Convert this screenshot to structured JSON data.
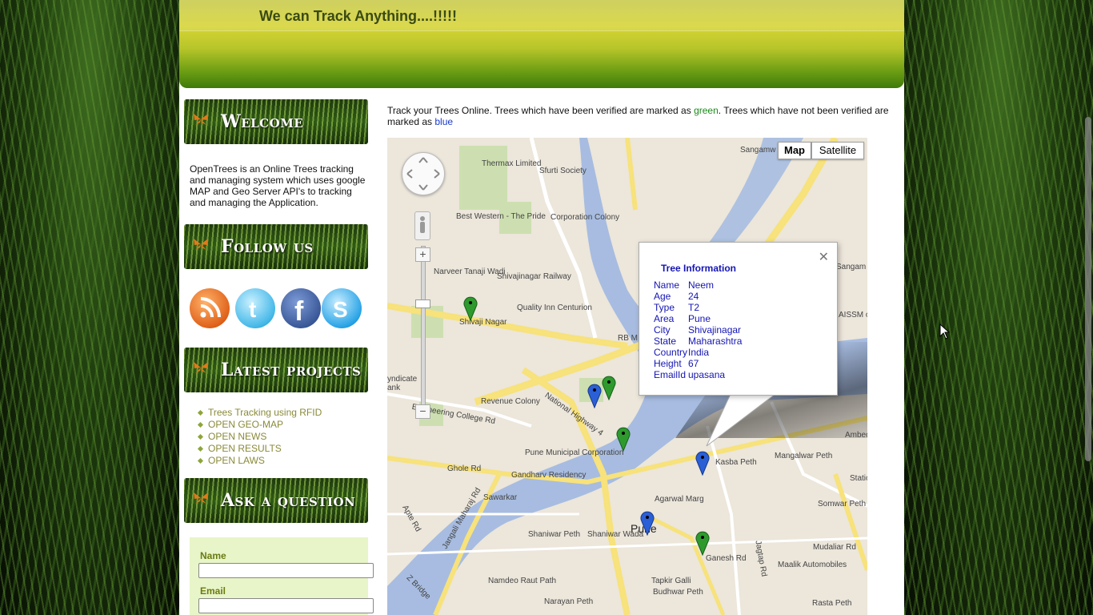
{
  "header": {
    "tagline": "We can Track Anything....!!!!!"
  },
  "sidebar": {
    "welcome_title": "Welcome",
    "intro": "OpenTrees is an Online Trees tracking and managing system which uses google MAP and Geo Server API's to tracking and managing the Application.",
    "follow_title": "Follow us",
    "social": [
      "rss-icon",
      "twitter-icon",
      "facebook-icon",
      "skype-icon"
    ],
    "projects_title": "Latest projects",
    "projects": [
      "Trees Tracking using RFID",
      "OPEN GEO-MAP",
      "OPEN NEWS",
      "OPEN RESULTS",
      "OPEN LAWS"
    ],
    "ask_title": "Ask a question",
    "form": {
      "name_label": "Name",
      "email_label": "Email",
      "name_value": "",
      "email_value": ""
    }
  },
  "content": {
    "desc_prefix": "Track your Trees Online. Trees which have been verified are marked as ",
    "desc_green": "green",
    "desc_mid": ". Trees which have not been verified are marked as ",
    "desc_blue": "blue",
    "colors": {
      "verified": "#2e9a2e",
      "unverified": "#2b5fd6"
    }
  },
  "map": {
    "type_map": "Map",
    "type_satellite": "Satellite",
    "selected_type": "Map",
    "labels": {
      "thermax": "Thermax Limited",
      "sfurti": "Sfurti Society",
      "bestwestern": "Best Western - The Pride",
      "corporation": "Corporation Colony",
      "narveer": "Narveer Tanaji Wadi",
      "shivajinagar_rly": "Shivajinagar Railway",
      "quality": "Quality Inn Centurion",
      "shivaji": "Shivaji Nagar",
      "revenue": "Revenue Colony",
      "engg": "Engineering College Rd",
      "nh4": "National Highway 4",
      "pmc": "Pune Municipal Corporation",
      "gandharv": "Gandharv Residency",
      "ghole": "Ghole Rd",
      "sawarkar": "Sawarkar",
      "kasba": "Kasba Peth",
      "mangalwar": "Mangalwar Peth",
      "agarwal": "Agarwal Marg",
      "somwar": "Somwar Peth",
      "shaniwar": "Shaniwar Peth",
      "shaniwarwada": "Shaniwar Wada",
      "pune": "Pune",
      "budhwar": "Budhwar Peth",
      "ganesh": "Ganesh Rd",
      "mudaliar": "Mudaliar Rd",
      "maalik": "Maalik Automobiles",
      "rasta": "Rasta Peth",
      "narayan": "Narayan Peth",
      "tapkir": "Tapkir Galli",
      "namdeo": "Namdeo Raut Path",
      "sangamw": "Sangamw",
      "sangam": "Sangam",
      "aissm": "AISSM of Phar",
      "rbm": "RB M",
      "jangali": "Jangali Maharaj Rd",
      "apte": "Apte Rd",
      "syndicate": "yndicate ank",
      "jagtap": "Jagtap Rd",
      "station": "Statio",
      "ambed": "Ambed",
      "zbridge": "Z Bridge"
    },
    "info": {
      "title": "Tree Information",
      "rows": [
        {
          "k": "Name",
          "v": "Neem"
        },
        {
          "k": "Age",
          "v": "24"
        },
        {
          "k": "Type",
          "v": "T2"
        },
        {
          "k": "Area",
          "v": "Pune"
        },
        {
          "k": "City",
          "v": "Shivajinagar"
        },
        {
          "k": "State",
          "v": "Maharashtra"
        },
        {
          "k": "Country",
          "v": "India"
        },
        {
          "k": "Height",
          "v": "67"
        },
        {
          "k": "EmailId",
          "v": "upasana"
        }
      ]
    }
  }
}
